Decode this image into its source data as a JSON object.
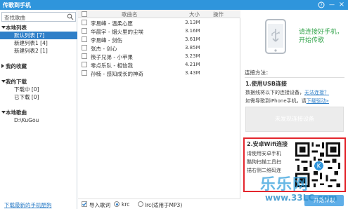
{
  "window": {
    "title": "传歌到手机",
    "controls": {
      "help_icon": "help-icon",
      "minimize": "—",
      "close": "×"
    }
  },
  "sidebar": {
    "search_placeholder": "查找歌曲",
    "groups": [
      {
        "label": "本地列表",
        "expanded": true,
        "children": [
          "默认列表 [7]",
          "新建列表1 [4]",
          "新建列表2 [1]"
        ]
      },
      {
        "label": "我的收藏",
        "expanded": false,
        "children": []
      },
      {
        "label": "我的下载",
        "expanded": true,
        "children": [
          "下载中 [0]",
          "已下载 [0]"
        ]
      },
      {
        "label": "本地歌曲",
        "expanded": true,
        "children": [
          "D:\\KuGou"
        ]
      }
    ],
    "selected_child": "默认列表 [7]",
    "download_link": "下载最新的手机酷狗"
  },
  "song_table": {
    "headers": {
      "name": "歌曲名",
      "size": "大小",
      "action": "操作"
    },
    "rows": [
      {
        "name": "李易峰 - 温柔心愿",
        "size": "3.13M"
      },
      {
        "name": "华晨宇 - 烟火里的尘埃",
        "size": "3.16M"
      },
      {
        "name": "李易峰 - 剑伤",
        "size": "3.61M"
      },
      {
        "name": "张杰 - 剑心",
        "size": "3.85M"
      },
      {
        "name": "筷子兄弟 - 小苹果",
        "size": "3.23M"
      },
      {
        "name": "零点乐队 - 相信我",
        "size": "4.21M"
      },
      {
        "name": "孙楠 - 感知成长的神奇",
        "size": "3.43M"
      }
    ]
  },
  "footer": {
    "import_lyrics_label": "导入歌词",
    "import_lyrics_checked": true,
    "format_lrc": "krc",
    "format_lrc_mp3": "lrc(适用于MP3)",
    "selected_format": "krc"
  },
  "connect_panel": {
    "prompt": "请连接好手机，开始传歌",
    "methods_label": "连接方法：",
    "usb": {
      "title": "1.使用USB连接",
      "line1_prefix": "数据线将以下的连接设备，",
      "line1_link": "无法连接？",
      "line2_prefix": "如需导歌到iPhone手机，请",
      "line2_link": "下载驱动»"
    },
    "no_device": "未发现连接设备",
    "wifi": {
      "title": "2.安卓Wifi连接",
      "lines": [
        "请使用安卓手机",
        "酷狗扫描工具扫",
        "描右侧二维码连"
      ]
    },
    "transfer_button": "开始传歌"
  },
  "watermark": {
    "brand": "乐乐网",
    "url": "www.33LC.com"
  },
  "colors": {
    "title_bar": "#2f95dc",
    "selection": "#2f7fc8",
    "prompt_green": "#37a64f",
    "wifi_border": "#e3262d"
  }
}
